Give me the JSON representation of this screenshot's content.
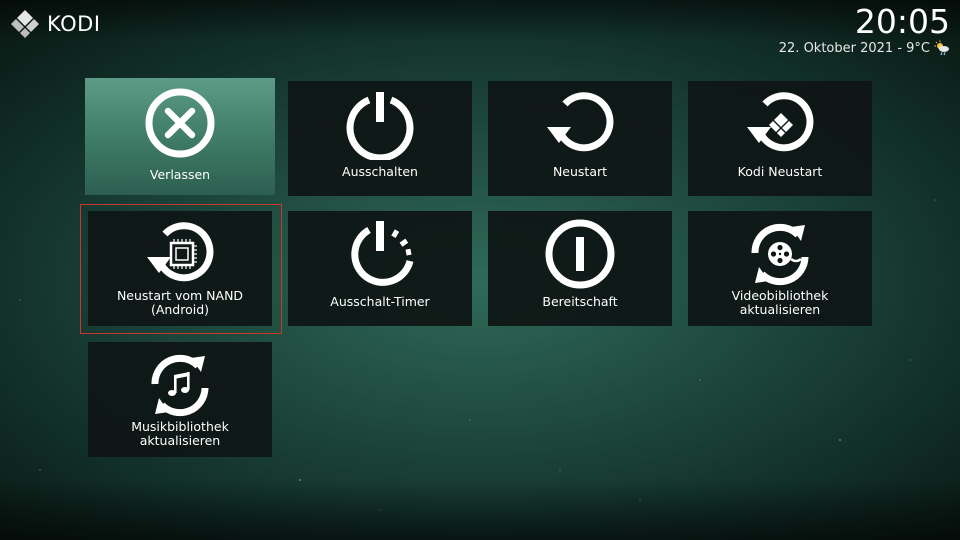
{
  "header": {
    "logo_text": "KODI",
    "time": "20:05",
    "date": "22. Oktober 2021 - 9°C",
    "weather_icon": "partly-cloudy-rain-icon"
  },
  "menu": {
    "items": [
      {
        "id": "exit",
        "label": "Verlassen",
        "icon": "close-circle-icon",
        "focused": true
      },
      {
        "id": "power-off",
        "label": "Ausschalten",
        "icon": "power-icon"
      },
      {
        "id": "reboot",
        "label": "Neustart",
        "icon": "restart-icon"
      },
      {
        "id": "kodi-restart",
        "label": "Kodi Neustart",
        "icon": "kodi-restart-icon"
      },
      {
        "id": "reboot-nand",
        "label": "Neustart vom NAND\n(Android)",
        "icon": "reboot-chip-icon",
        "selected_frame": true
      },
      {
        "id": "shutdown-timer",
        "label": "Ausschalt-Timer",
        "icon": "timer-power-icon"
      },
      {
        "id": "standby",
        "label": "Bereitschaft",
        "icon": "standby-icon"
      },
      {
        "id": "video-library",
        "label": "Videobibliothek\naktualisieren",
        "icon": "film-reel-refresh-icon"
      },
      {
        "id": "music-library",
        "label": "Musikbibliothek\naktualisieren",
        "icon": "music-refresh-icon"
      }
    ]
  },
  "colors": {
    "tile_bg": "#0e1614",
    "tile_focused": "#4f8f7b",
    "selection_frame": "#c8372d",
    "kodi_logo": "#2e9bd1"
  }
}
